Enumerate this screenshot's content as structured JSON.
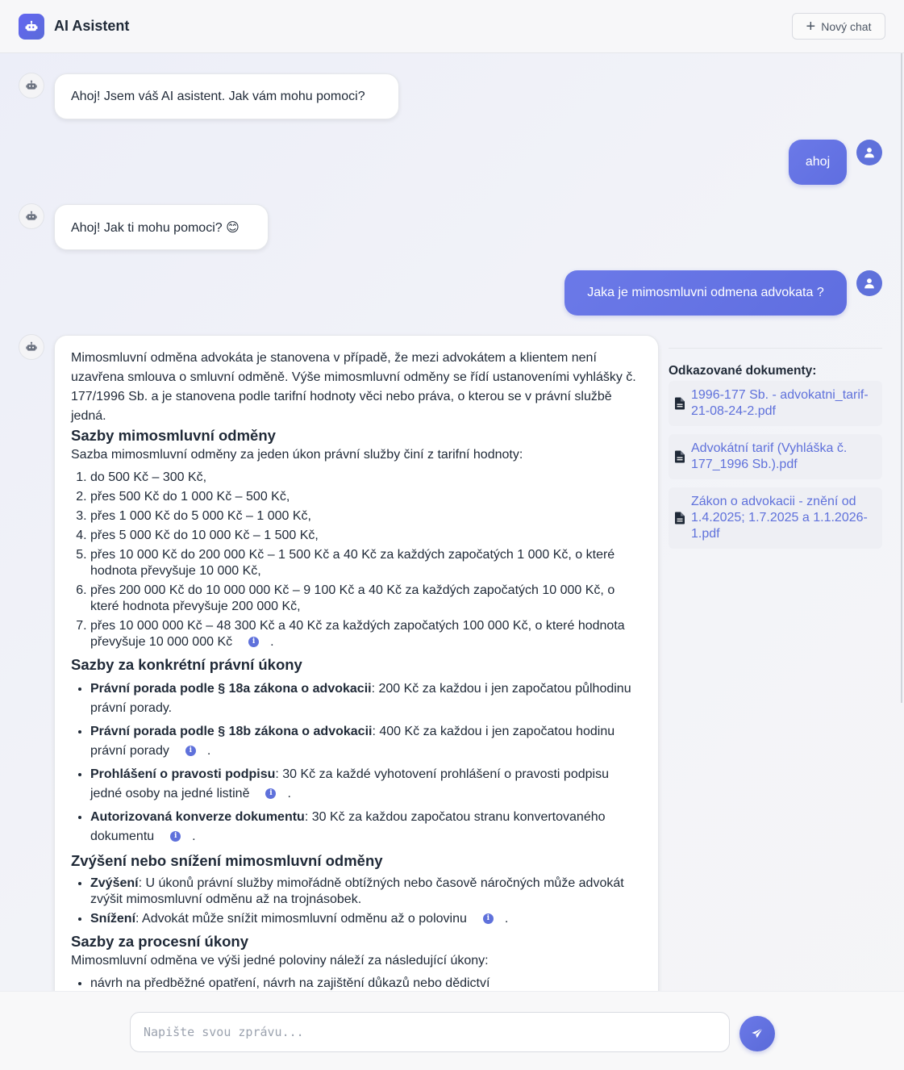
{
  "header": {
    "title": "AI Asistent",
    "new_chat_label": "Nový chat"
  },
  "messages": [
    {
      "role": "assistant",
      "text": "Ahoj! Jsem váš AI asistent. Jak vám mohu pomoci?"
    },
    {
      "role": "user",
      "text": "ahoj"
    },
    {
      "role": "assistant",
      "text": "Ahoj! Jak ti mohu pomoci? 😊"
    },
    {
      "role": "user",
      "text": "Jaka je mimosmluvni odmena advokata ?"
    }
  ],
  "answer": {
    "intro": "Mimosmluvní odměna advokáta je stanovena v případě, že mezi advokátem a klientem není uzavřena smlouva o smluvní odměně. Výše mimosmluvní odměny se řídí ustanoveními vyhlášky č. 177/1996 Sb. a je stanovena podle tarifní hodnoty věci nebo práva, o kterou se v právní službě jedná.",
    "s1": {
      "heading": "Sazby mimosmluvní odměny",
      "text": "Sazba mimosmluvní odměny za jeden úkon právní služby činí z tarifní hodnoty:",
      "items": [
        "do 500 Kč – 300 Kč,",
        "přes 500 Kč do 1 000 Kč – 500 Kč,",
        "přes 1 000 Kč do 5 000 Kč – 1 000 Kč,",
        "přes 5 000 Kč do 10 000 Kč – 1 500 Kč,",
        "přes 10 000 Kč do 200 000 Kč – 1 500 Kč a 40 Kč za každých započatých 1 000 Kč, o které hodnota převyšuje 10 000 Kč,",
        "přes 200 000 Kč do 10 000 000 Kč – 9 100 Kč a 40 Kč za každých započatých 10 000 Kč, o které hodnota převyšuje 200 000 Kč,",
        "přes 10 000 000 Kč – 48 300 Kč a 40 Kč za každých započatých 100 000 Kč, o které hodnota převyšuje 10 000 000 Kč"
      ]
    },
    "s2": {
      "heading": "Sazby za konkrétní právní úkony",
      "items": [
        {
          "b": "Právní porada podle § 18a zákona o advokacii",
          "t": ": 200 Kč za každou i jen započatou půlhodinu právní porady."
        },
        {
          "b": "Právní porada podle § 18b zákona o advokacii",
          "t": ": 400 Kč za každou i jen započatou hodinu právní porady"
        },
        {
          "b": "Prohlášení o pravosti podpisu",
          "t": ": 30 Kč za každé vyhotovení prohlášení o pravosti podpisu jedné osoby na jedné listině"
        },
        {
          "b": "Autorizovaná konverze dokumentu",
          "t": ": 30 Kč za každou započatou stranu konvertovaného dokumentu"
        }
      ]
    },
    "s3": {
      "heading": "Zvýšení nebo snížení mimosmluvní odměny",
      "items": [
        {
          "b": "Zvýšení",
          "t": ": U úkonů právní služby mimořádně obtížných nebo časově náročných může advokát zvýšit mimosmluvní odměnu až na trojnásobek."
        },
        {
          "b": "Snížení",
          "t": ": Advokát může snížit mimosmluvní odměnu až o polovinu"
        }
      ]
    },
    "s4": {
      "heading": "Sazby za procesní úkony",
      "text": "Mimosmluvní odměna ve výši jedné poloviny náleží za následující úkony:",
      "items": [
        "návrh na předběžné opatření, návrh na zajištění důkazů nebo dědictví"
      ]
    },
    "period": "."
  },
  "references": {
    "title": "Odkazované dokumenty:",
    "items": [
      "1996-177 Sb. - advokatni_tarif-21-08-24-2.pdf",
      "Advokátní tarif (Vyhláška č. 177_1996 Sb.).pdf",
      "Zákon o advokacii - znění od 1.4.2025; 1.7.2025 a 1.1.2026-1.pdf"
    ]
  },
  "input": {
    "placeholder": "Napište svou zprávu...",
    "value": ""
  },
  "icons": {
    "logo": "robot-icon",
    "bot_avatar": "robot-icon",
    "user_avatar": "user-icon",
    "new_chat": "plus-icon",
    "reference": "document-icon",
    "citation": "info-icon",
    "send": "paper-plane-icon"
  },
  "colors": {
    "accent": "#5f71db",
    "user_bubble": "#6373e2",
    "link": "#5f71db"
  }
}
